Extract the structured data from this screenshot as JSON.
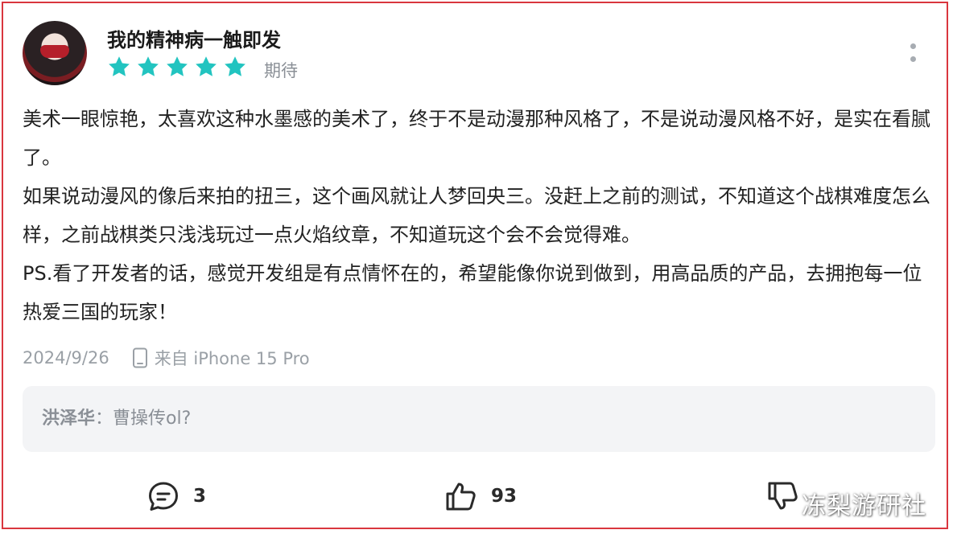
{
  "user": {
    "name": "我的精神病一触即发",
    "rating_label": "期待",
    "stars": 5
  },
  "review": {
    "paragraphs": [
      "美术一眼惊艳，太喜欢这种水墨感的美术了，终于不是动漫那种风格了，不是说动漫风格不好，是实在看腻了。",
      "如果说动漫风的像后来拍的扭三，这个画风就让人梦回央三。没赶上之前的测试，不知道这个战棋难度怎么样，之前战棋类只浅浅玩过一点火焰纹章，不知道玩这个会不会觉得难。",
      "PS.看了开发者的话，感觉开发组是有点情怀在的，希望能像你说到做到，用高品质的产品，去拥抱每一位热爱三国的玩家！"
    ]
  },
  "meta": {
    "date": "2024/9/26",
    "device": "来自 iPhone 15 Pro"
  },
  "reply": {
    "author": "洪泽华",
    "separator": "：",
    "text": "曹操传ol?"
  },
  "actions": {
    "comments": "3",
    "likes": "93"
  },
  "watermark": "冻梨游研社",
  "colors": {
    "star": "#22c4c0",
    "frame_border": "#d9363e",
    "reply_bg": "#f3f4f6"
  }
}
